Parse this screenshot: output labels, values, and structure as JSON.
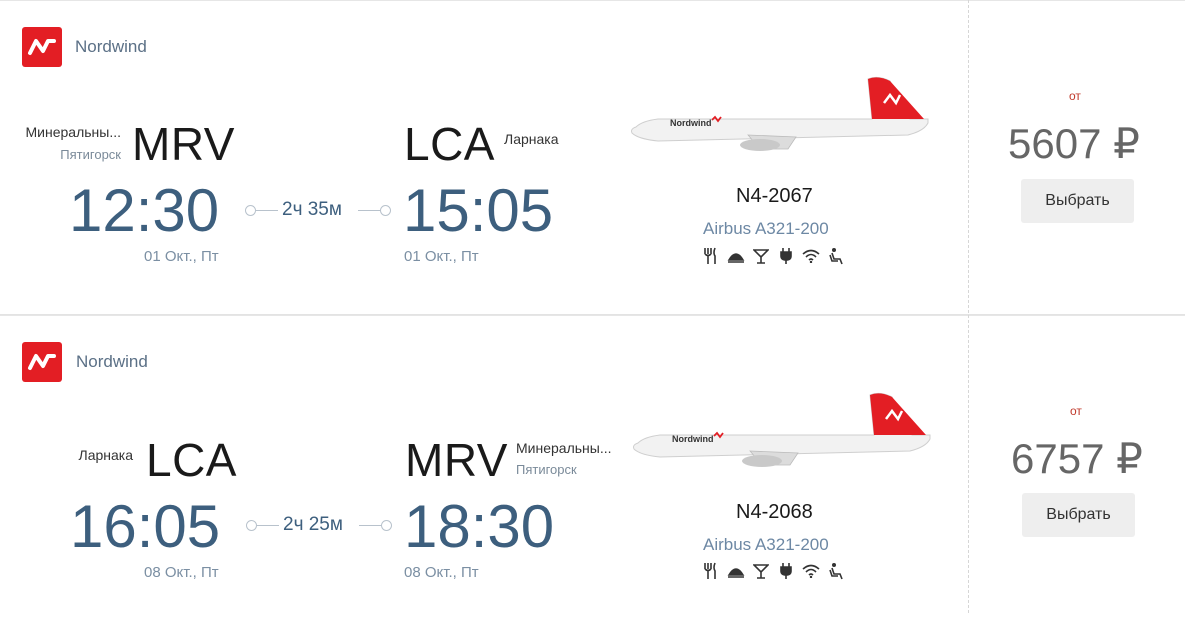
{
  "flights": [
    {
      "airline": "Nordwind",
      "origin": {
        "city": "Минеральны...",
        "subcity": "Пятигорск",
        "code": "MRV",
        "time": "12:30",
        "date": "01 Окт., Пт"
      },
      "destination": {
        "city": "Ларнака",
        "subcity": "",
        "code": "LCA",
        "time": "15:05",
        "date": "01 Окт., Пт"
      },
      "duration": "2ч 35м",
      "flight_number": "N4-2067",
      "aircraft": "Airbus A321-200",
      "amenities": [
        "meal-icon",
        "hot-food-icon",
        "drinks-icon",
        "power-outlet-icon",
        "wifi-icon",
        "seat-icon"
      ],
      "price_prefix": "от",
      "price": "5607 ₽",
      "select_label": "Выбрать"
    },
    {
      "airline": "Nordwind",
      "origin": {
        "city": "Ларнака",
        "subcity": "",
        "code": "LCA",
        "time": "16:05",
        "date": "08 Окт., Пт"
      },
      "destination": {
        "city": "Минеральны...",
        "subcity": "Пятигорск",
        "code": "MRV",
        "time": "18:30",
        "date": "08 Окт., Пт"
      },
      "duration": "2ч 25м",
      "flight_number": "N4-2068",
      "aircraft": "Airbus A321-200",
      "amenities": [
        "meal-icon",
        "hot-food-icon",
        "drinks-icon",
        "power-outlet-icon",
        "wifi-icon",
        "seat-icon"
      ],
      "price_prefix": "от",
      "price": "6757 ₽",
      "select_label": "Выбрать"
    }
  ],
  "colors": {
    "brand": "#e31e24",
    "time": "#3d5f7e",
    "accent_text": "#c0392b"
  }
}
